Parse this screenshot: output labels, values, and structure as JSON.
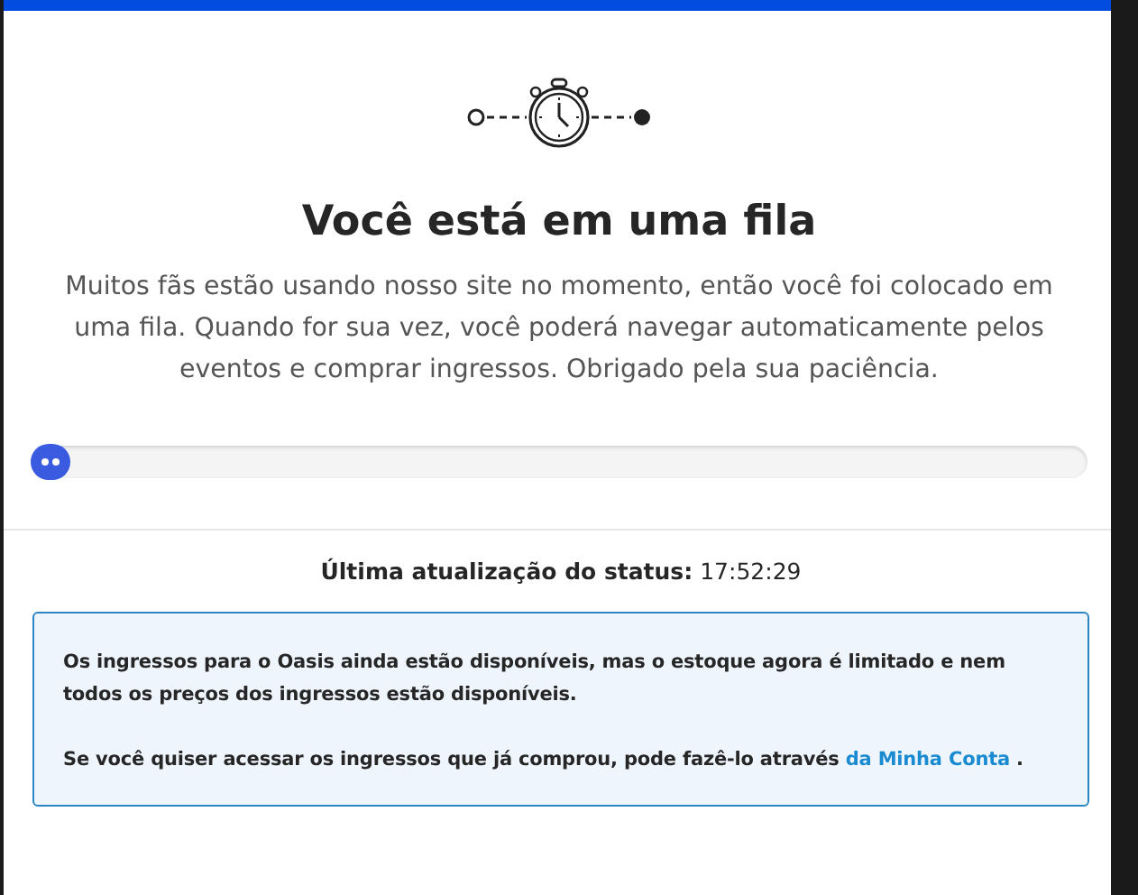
{
  "heading": "Você está em uma fila",
  "message": "Muitos fãs estão usando nosso site no momento, então você foi colocado em uma fila. Quando for sua vez, você poderá navegar automaticamente pelos eventos e comprar ingressos. Obrigado pela sua paciência.",
  "status": {
    "label": "Última atualização do status:",
    "time": "17:52:29"
  },
  "notice": {
    "paragraph": "Os ingressos para o Oasis ainda estão disponíveis, mas o estoque agora é limitado e nem todos os preços dos ingressos estão disponíveis.",
    "account_text": "Se você quiser acessar os ingressos que já comprou, pode fazê-lo através",
    "account_link": "da Minha Conta",
    "account_end": "."
  }
}
